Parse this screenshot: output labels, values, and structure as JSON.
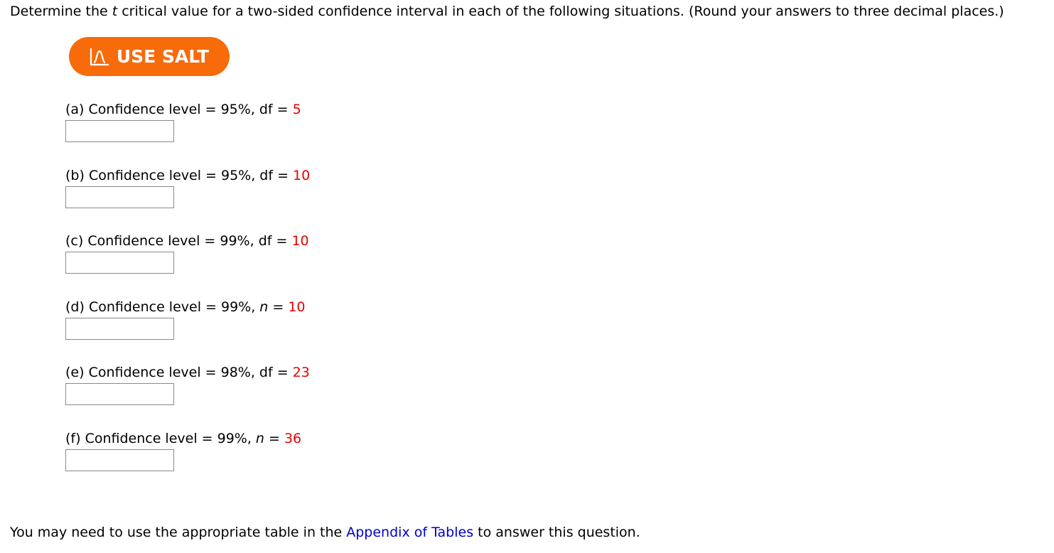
{
  "intro": {
    "before_t": "Determine the ",
    "t_symbol": "t",
    "after_t": " critical value for a two-sided confidence interval in each of the following situations. (Round your answers to three decimal places.)"
  },
  "salt_button": {
    "label": "USE SALT",
    "icon": "salt-distribution-icon",
    "color": "#f76b0b"
  },
  "parts": [
    {
      "letter": "(a)",
      "prefix": "Confidence level = 95%, ",
      "var": "df",
      "eq": " = ",
      "value": "5",
      "answer": ""
    },
    {
      "letter": "(b)",
      "prefix": "Confidence level = 95%, ",
      "var": "df",
      "eq": " = ",
      "value": "10",
      "answer": ""
    },
    {
      "letter": "(c)",
      "prefix": "Confidence level = 99%, ",
      "var": "df",
      "eq": " = ",
      "value": "10",
      "answer": ""
    },
    {
      "letter": "(d)",
      "prefix": "Confidence level = 99%, ",
      "var": "n",
      "eq": " = ",
      "value": "10",
      "answer": ""
    },
    {
      "letter": "(e)",
      "prefix": "Confidence level = 98%, ",
      "var": "df",
      "eq": " = ",
      "value": "23",
      "answer": ""
    },
    {
      "letter": "(f)",
      "prefix": "Confidence level = 99%, ",
      "var": "n",
      "eq": " = ",
      "value": "36",
      "answer": ""
    }
  ],
  "footer": {
    "before": "You may need to use the appropriate table in the ",
    "link": "Appendix of Tables",
    "after": " to answer this question."
  },
  "colors": {
    "given_value": "#e60000",
    "link": "#0000cc"
  }
}
